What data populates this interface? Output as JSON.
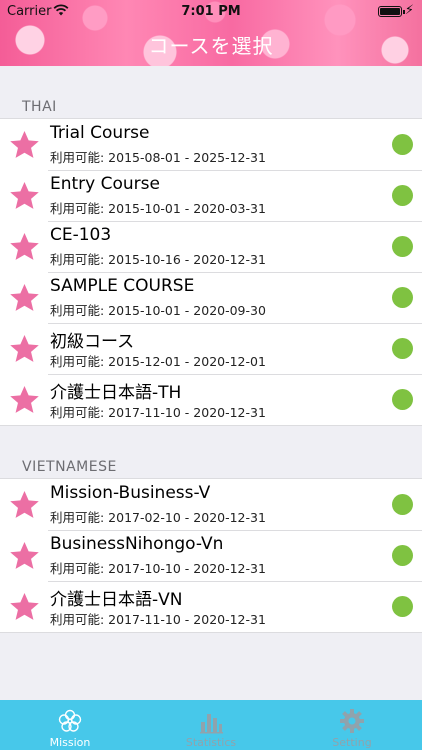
{
  "status_bar": {
    "carrier": "Carrier",
    "time": "7:01 PM"
  },
  "nav": {
    "title": "コースを選択"
  },
  "colors": {
    "accent": "#47c8ea",
    "status_available": "#7fc241",
    "star": "#ec6fa4"
  },
  "sections": [
    {
      "title": "THAI",
      "courses": [
        {
          "name": "Trial Course",
          "period": "利用可能: 2015-08-01 - 2025-12-31"
        },
        {
          "name": "Entry Course",
          "period": "利用可能: 2015-10-01 - 2020-03-31"
        },
        {
          "name": "CE-103",
          "period": "利用可能: 2015-10-16 - 2020-12-31"
        },
        {
          "name": "SAMPLE COURSE",
          "period": "利用可能: 2015-10-01 - 2020-09-30"
        },
        {
          "name": "初級コース",
          "period": "利用可能: 2015-12-01 - 2020-12-01"
        },
        {
          "name": "介護士日本語-TH",
          "period": "利用可能: 2017-11-10 - 2020-12-31"
        }
      ]
    },
    {
      "title": "VIETNAMESE",
      "courses": [
        {
          "name": "Mission-Business-V",
          "period": "利用可能: 2017-02-10 - 2020-12-31"
        },
        {
          "name": "BusinessNihongo-Vn",
          "period": "利用可能: 2017-10-10 - 2020-12-31"
        },
        {
          "name": "介護士日本語-VN",
          "period": "利用可能: 2017-11-10 - 2020-12-31"
        }
      ]
    }
  ],
  "tabs": [
    {
      "label": "Mission",
      "icon": "flower-icon",
      "active": true
    },
    {
      "label": "Statistics",
      "icon": "bar-chart-icon",
      "active": false
    },
    {
      "label": "Setting",
      "icon": "gear-icon",
      "active": false
    }
  ]
}
